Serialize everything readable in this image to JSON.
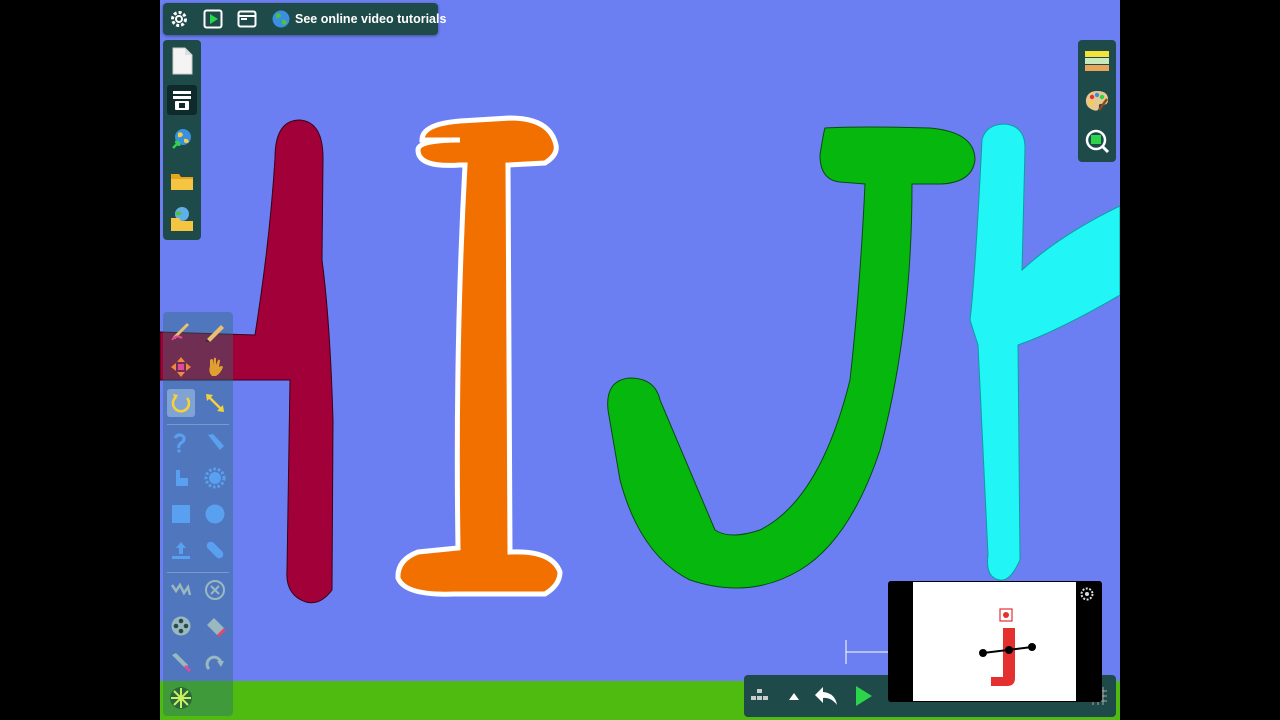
{
  "toolbar": {
    "tutorial_label": "See online video tutorials",
    "icons": [
      "gear-icon",
      "play-icon",
      "window-icon",
      "globe-icon"
    ]
  },
  "left_sidebar": [
    "new-document-icon",
    "frames-icon",
    "web-import-icon",
    "folder-icon",
    "library-icon"
  ],
  "right_sidebar": [
    "layers-icon",
    "palette-icon",
    "zoom-icon"
  ],
  "tools": [
    "brush-tool",
    "pencil-tool",
    "move-tool",
    "hand-tool",
    "rotate-tool",
    "scale-tool",
    "curve-tool",
    "line-tool",
    "corner-tool",
    "gear-shape-tool",
    "rectangle-tool",
    "circle-tool",
    "upload-tool",
    "bandage-tool",
    "zigzag-tool",
    "remove-tool",
    "reel-tool",
    "eraser-tool",
    "knife-tool",
    "redo-tool",
    "spiral-tool"
  ],
  "bottom_bar": [
    "frames-grid-icon",
    "up-arrow-icon",
    "undo-icon",
    "play-icon",
    "grid-icon"
  ],
  "colors": {
    "background": "#6b7ff2",
    "ground": "#4fba0f",
    "letter_h": "#a10038",
    "letter_i": "#f27000",
    "letter_j": "#06b80e",
    "letter_k": "#22f5f5",
    "panel": "#1e4a49"
  },
  "canvas_letters": [
    "H",
    "I",
    "J",
    "K"
  ]
}
